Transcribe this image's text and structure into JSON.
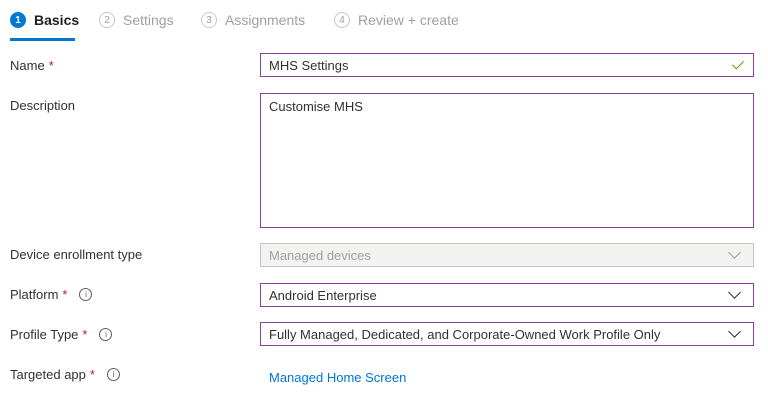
{
  "steps": [
    {
      "num": "1",
      "label": "Basics"
    },
    {
      "num": "2",
      "label": "Settings"
    },
    {
      "num": "3",
      "label": "Assignments"
    },
    {
      "num": "4",
      "label": "Review + create"
    }
  ],
  "form": {
    "name": {
      "label": "Name",
      "value": "MHS Settings"
    },
    "description": {
      "label": "Description",
      "value": "Customise MHS"
    },
    "enrollment": {
      "label": "Device enrollment type",
      "value": "Managed devices"
    },
    "platform": {
      "label": "Platform",
      "value": "Android Enterprise"
    },
    "profile_type": {
      "label": "Profile Type",
      "value": "Fully Managed, Dedicated, and Corporate-Owned Work Profile Only"
    },
    "targeted_app": {
      "label": "Targeted app",
      "value": "Managed Home Screen"
    },
    "required_mark": "*",
    "info_glyph": "i"
  }
}
